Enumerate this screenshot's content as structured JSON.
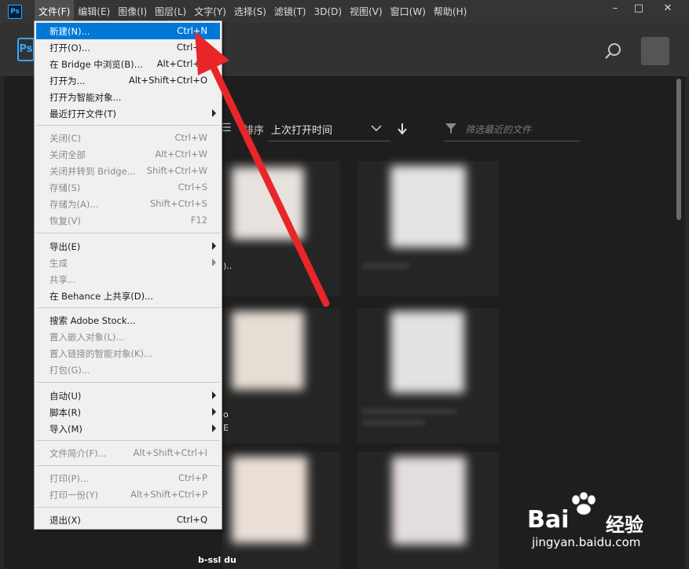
{
  "menubar": {
    "logo": "Ps",
    "items": [
      {
        "label": "文件(F)"
      },
      {
        "label": "编辑(E)"
      },
      {
        "label": "图像(I)"
      },
      {
        "label": "图层(L)"
      },
      {
        "label": "文字(Y)"
      },
      {
        "label": "选择(S)"
      },
      {
        "label": "滤镜(T)"
      },
      {
        "label": "3D(D)"
      },
      {
        "label": "视图(V)"
      },
      {
        "label": "窗口(W)"
      },
      {
        "label": "帮助(H)"
      }
    ],
    "window_controls": {
      "minimize": "–",
      "maximize": "□",
      "close": "✕"
    }
  },
  "home": {
    "logo": "Ps",
    "sort_label": "排序",
    "sort_value": "上次打开时间",
    "filter_placeholder": "筛选最近的文件",
    "fragments": [
      ")..",
      "o",
      "E",
      "b-ssl du"
    ]
  },
  "file_menu": {
    "groups": [
      [
        {
          "label": "新建(N)...",
          "shortcut": "Ctrl+N",
          "highlight": true
        },
        {
          "label": "打开(O)...",
          "shortcut": "Ctrl+O"
        },
        {
          "label": "在 Bridge 中浏览(B)...",
          "shortcut": "Alt+Ctrl+O"
        },
        {
          "label": "打开为...",
          "shortcut": "Alt+Shift+Ctrl+O"
        },
        {
          "label": "打开为智能对象...",
          "shortcut": ""
        },
        {
          "label": "最近打开文件(T)",
          "shortcut": "",
          "submenu": true
        }
      ],
      [
        {
          "label": "关闭(C)",
          "shortcut": "Ctrl+W",
          "disabled": true
        },
        {
          "label": "关闭全部",
          "shortcut": "Alt+Ctrl+W",
          "disabled": true
        },
        {
          "label": "关闭并转到 Bridge...",
          "shortcut": "Shift+Ctrl+W",
          "disabled": true
        },
        {
          "label": "存储(S)",
          "shortcut": "Ctrl+S",
          "disabled": true
        },
        {
          "label": "存储为(A)...",
          "shortcut": "Shift+Ctrl+S",
          "disabled": true
        },
        {
          "label": "恢复(V)",
          "shortcut": "F12",
          "disabled": true
        }
      ],
      [
        {
          "label": "导出(E)",
          "shortcut": "",
          "submenu": true
        },
        {
          "label": "生成",
          "shortcut": "",
          "submenu": true,
          "disabled": true
        },
        {
          "label": "共享...",
          "shortcut": "",
          "disabled": true
        },
        {
          "label": "在 Behance 上共享(D)...",
          "shortcut": ""
        }
      ],
      [
        {
          "label": "搜索 Adobe Stock...",
          "shortcut": ""
        },
        {
          "label": "置入嵌入对象(L)...",
          "shortcut": "",
          "disabled": true
        },
        {
          "label": "置入链接的智能对象(K)...",
          "shortcut": "",
          "disabled": true
        },
        {
          "label": "打包(G)...",
          "shortcut": "",
          "disabled": true
        }
      ],
      [
        {
          "label": "自动(U)",
          "shortcut": "",
          "submenu": true
        },
        {
          "label": "脚本(R)",
          "shortcut": "",
          "submenu": true
        },
        {
          "label": "导入(M)",
          "shortcut": "",
          "submenu": true
        }
      ],
      [
        {
          "label": "文件简介(F)...",
          "shortcut": "Alt+Shift+Ctrl+I",
          "disabled": true
        }
      ],
      [
        {
          "label": "打印(P)...",
          "shortcut": "Ctrl+P",
          "disabled": true
        },
        {
          "label": "打印一份(Y)",
          "shortcut": "Alt+Shift+Ctrl+P",
          "disabled": true
        }
      ],
      [
        {
          "label": "退出(X)",
          "shortcut": "Ctrl+Q"
        }
      ]
    ]
  },
  "watermark": {
    "brand_left": "Bai",
    "brand_right": "经验",
    "url": "jingyan.baidu.com"
  },
  "colors": {
    "accent": "#0078d7",
    "ps_blue": "#31a8ff",
    "annotation_red": "#e8262a"
  }
}
